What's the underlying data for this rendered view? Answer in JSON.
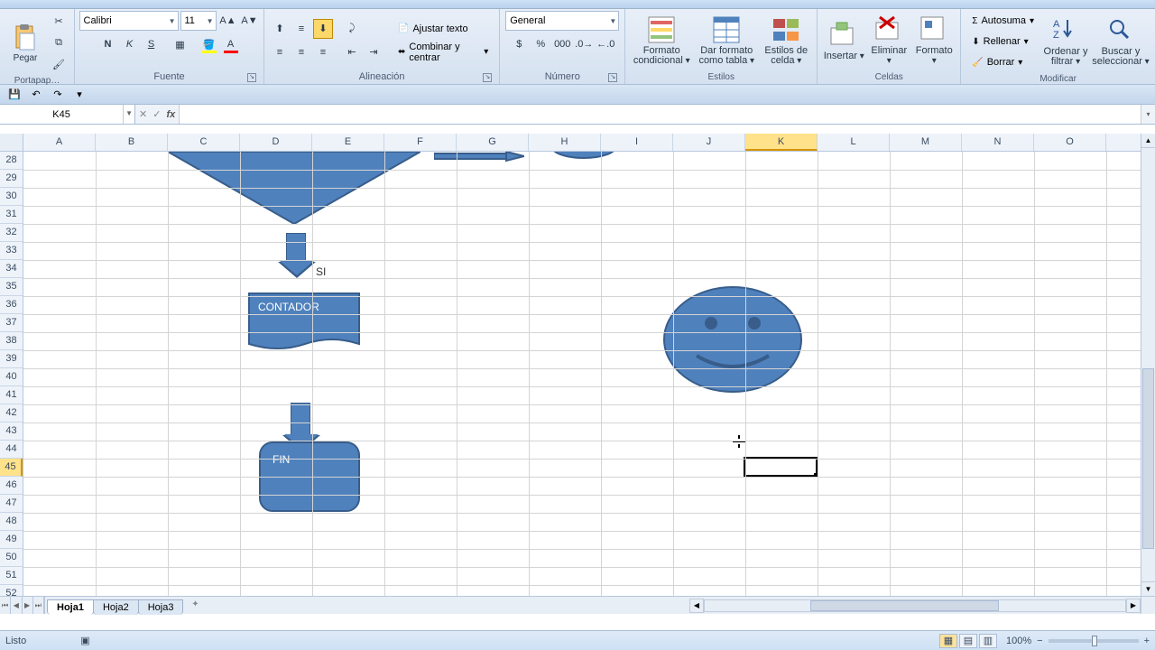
{
  "qat": {
    "save": "💾",
    "undo": "↶",
    "redo": "↷"
  },
  "ribbon": {
    "clipboard": {
      "paste": "Pegar",
      "label": "Portapap…"
    },
    "font": {
      "name": "Calibri",
      "size": "11",
      "bold": "N",
      "italic": "K",
      "underline": "S",
      "label": "Fuente"
    },
    "alignment": {
      "wrap": "Ajustar texto",
      "merge": "Combinar y centrar",
      "label": "Alineación"
    },
    "number": {
      "format": "General",
      "label": "Número"
    },
    "styles": {
      "cond": "Formato condicional",
      "table": "Dar formato como tabla",
      "cell": "Estilos de celda",
      "label": "Estilos"
    },
    "cells": {
      "insert": "Insertar",
      "delete": "Eliminar",
      "format": "Formato",
      "label": "Celdas"
    },
    "editing": {
      "sum": "Autosuma",
      "fill": "Rellenar",
      "clear": "Borrar",
      "sort": "Ordenar y filtrar",
      "find": "Buscar y seleccionar",
      "label": "Modificar"
    }
  },
  "namebox": "K45",
  "columns": [
    "A",
    "B",
    "C",
    "D",
    "E",
    "F",
    "G",
    "H",
    "I",
    "J",
    "K",
    "L",
    "M",
    "N",
    "O"
  ],
  "first_row": 28,
  "row_count": 25,
  "selected_col": "K",
  "selected_row": 45,
  "shapes": {
    "decision_label": "SI",
    "contador": "CONTADOR",
    "fin": "FIN"
  },
  "sheets": {
    "active": "Hoja1",
    "tabs": [
      "Hoja1",
      "Hoja2",
      "Hoja3"
    ]
  },
  "status": {
    "ready": "Listo",
    "zoom": "100%"
  }
}
